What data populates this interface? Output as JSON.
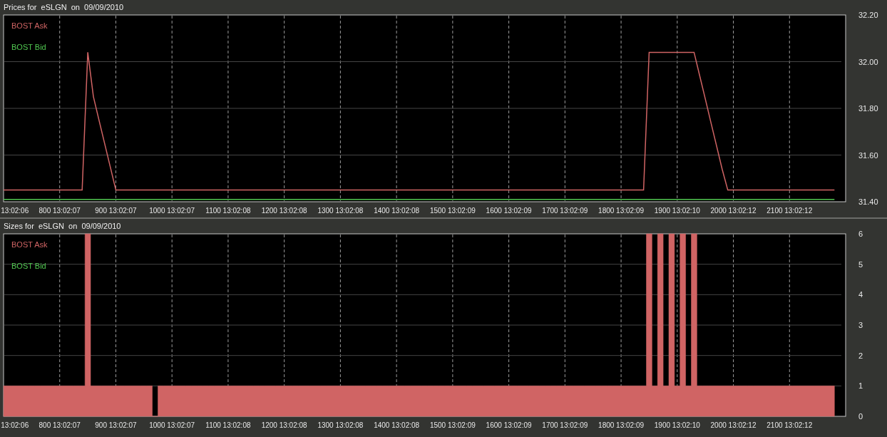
{
  "panels": [
    {
      "title": "Prices for  eSLGN  on  09/09/2010",
      "chart_data": {
        "type": "line",
        "grid": true,
        "categories": [
          null,
          null,
          "13:02:06",
          null,
          null,
          null,
          null,
          null,
          null,
          null,
          "800 13:02:07",
          null,
          null,
          null,
          null,
          null,
          null,
          null,
          null,
          null,
          "900 13:02:07",
          null,
          null,
          null,
          null,
          null,
          null,
          null,
          null,
          null,
          "1000 13:02:07",
          null,
          null,
          null,
          null,
          null,
          null,
          null,
          null,
          null,
          "1100 13:02:08",
          null,
          null,
          null,
          null,
          null,
          null,
          null,
          null,
          null,
          "1200 13:02:08",
          null,
          null,
          null,
          null,
          null,
          null,
          null,
          null,
          null,
          "1300 13:02:08",
          null,
          null,
          null,
          null,
          null,
          null,
          null,
          null,
          null,
          "1400 13:02:08",
          null,
          null,
          null,
          null,
          null,
          null,
          null,
          null,
          null,
          "1500 13:02:09",
          null,
          null,
          null,
          null,
          null,
          null,
          null,
          null,
          null,
          "1600 13:02:09",
          null,
          null,
          null,
          null,
          null,
          null,
          null,
          null,
          null,
          "1700 13:02:09",
          null,
          null,
          null,
          null,
          null,
          null,
          null,
          null,
          null,
          "1800 13:02:09",
          null,
          null,
          null,
          null,
          null,
          null,
          null,
          null,
          null,
          "1900 13:02:10",
          null,
          null,
          null,
          null,
          null,
          null,
          null,
          null,
          null,
          "2000 13:02:12",
          null,
          null,
          null,
          null,
          null,
          null,
          null,
          null,
          null,
          "2100 13:02:12",
          null,
          null,
          null,
          null,
          null,
          null,
          null,
          null,
          null,
          null
        ],
        "series": [
          {
            "name": "BOST Ask",
            "color": "#d06464",
            "values": [
              31.45,
              31.45,
              31.45,
              31.45,
              31.45,
              31.45,
              31.45,
              31.45,
              31.45,
              31.45,
              31.45,
              31.45,
              31.45,
              31.45,
              31.45,
              32.04,
              31.85,
              31.75,
              31.65,
              31.55,
              31.45,
              31.45,
              31.45,
              31.45,
              31.45,
              31.45,
              31.45,
              31.45,
              31.45,
              31.45,
              31.45,
              31.45,
              31.45,
              31.45,
              31.45,
              31.45,
              31.45,
              31.45,
              31.45,
              31.45,
              31.45,
              31.45,
              31.45,
              31.45,
              31.45,
              31.45,
              31.45,
              31.45,
              31.45,
              31.45,
              31.45,
              31.45,
              31.45,
              31.45,
              31.45,
              31.45,
              31.45,
              31.45,
              31.45,
              31.45,
              31.45,
              31.45,
              31.45,
              31.45,
              31.45,
              31.45,
              31.45,
              31.45,
              31.45,
              31.45,
              31.45,
              31.45,
              31.45,
              31.45,
              31.45,
              31.45,
              31.45,
              31.45,
              31.45,
              31.45,
              31.45,
              31.45,
              31.45,
              31.45,
              31.45,
              31.45,
              31.45,
              31.45,
              31.45,
              31.45,
              31.45,
              31.45,
              31.45,
              31.45,
              31.45,
              31.45,
              31.45,
              31.45,
              31.45,
              31.45,
              31.45,
              31.45,
              31.45,
              31.45,
              31.45,
              31.45,
              31.45,
              31.45,
              31.45,
              31.45,
              31.45,
              31.45,
              31.45,
              31.45,
              31.45,
              32.04,
              32.04,
              32.04,
              32.04,
              32.04,
              32.04,
              32.04,
              32.04,
              32.04,
              31.94,
              31.84,
              31.74,
              31.64,
              31.54,
              31.45,
              31.45,
              31.45,
              31.45,
              31.45,
              31.45,
              31.45,
              31.45,
              31.45,
              31.45,
              31.45,
              31.45,
              31.45,
              31.45,
              31.45,
              31.45,
              31.45,
              31.45,
              31.45,
              31.45,
              null,
              null
            ]
          },
          {
            "name": "BOST Bid",
            "color": "#50c850",
            "values": [
              31.41,
              31.41,
              31.41,
              31.41,
              31.41,
              31.41,
              31.41,
              31.41,
              31.41,
              31.41,
              31.41,
              31.41,
              31.41,
              31.41,
              31.41,
              31.41,
              31.41,
              31.41,
              31.41,
              31.41,
              31.41,
              31.41,
              31.41,
              31.41,
              31.41,
              31.41,
              31.41,
              31.41,
              31.41,
              31.41,
              31.41,
              31.41,
              31.41,
              31.41,
              31.41,
              31.41,
              31.41,
              31.41,
              31.41,
              31.41,
              31.41,
              31.41,
              31.41,
              31.41,
              31.41,
              31.41,
              31.41,
              31.41,
              31.41,
              31.41,
              31.41,
              31.41,
              31.41,
              31.41,
              31.41,
              31.41,
              31.41,
              31.41,
              31.41,
              31.41,
              31.41,
              31.41,
              31.41,
              31.41,
              31.41,
              31.41,
              31.41,
              31.41,
              31.41,
              31.41,
              31.41,
              31.41,
              31.41,
              31.41,
              31.41,
              31.41,
              31.41,
              31.41,
              31.41,
              31.41,
              31.41,
              31.41,
              31.41,
              31.41,
              31.41,
              31.41,
              31.41,
              31.41,
              31.41,
              31.41,
              31.41,
              31.41,
              31.41,
              31.41,
              31.41,
              31.41,
              31.41,
              31.41,
              31.41,
              31.41,
              31.41,
              31.41,
              31.41,
              31.41,
              31.41,
              31.41,
              31.41,
              31.41,
              31.41,
              31.41,
              31.41,
              31.41,
              31.41,
              31.41,
              31.41,
              31.41,
              31.41,
              31.41,
              31.41,
              31.41,
              31.41,
              31.41,
              31.41,
              31.41,
              31.41,
              31.41,
              31.41,
              31.41,
              31.41,
              31.41,
              31.41,
              31.41,
              31.41,
              31.41,
              31.41,
              31.41,
              31.41,
              31.41,
              31.41,
              31.41,
              31.41,
              31.41,
              31.41,
              31.41,
              31.41,
              31.41,
              31.41,
              31.41,
              31.41,
              null,
              null
            ]
          }
        ],
        "ylim": [
          31.4,
          32.2
        ],
        "yticks": [
          {
            "value": 31.4,
            "label": "31.40"
          },
          {
            "value": 31.6,
            "label": "31.60"
          },
          {
            "value": 31.8,
            "label": "31.80"
          },
          {
            "value": 32.0,
            "label": "32.00"
          },
          {
            "value": 32.2,
            "label": "32.20"
          }
        ]
      }
    },
    {
      "title": "Sizes for  eSLGN  on  09/09/2010",
      "legend": [
        {
          "label": "BOST Bid",
          "color": "#50c850"
        }
      ],
      "chart_data": {
        "type": "area",
        "grid": true,
        "categories": [
          null,
          null,
          "13:02:06",
          null,
          null,
          null,
          null,
          null,
          null,
          null,
          "800 13:02:07",
          null,
          null,
          null,
          null,
          null,
          null,
          null,
          null,
          null,
          "900 13:02:07",
          null,
          null,
          null,
          null,
          null,
          null,
          null,
          null,
          null,
          "1000 13:02:07",
          null,
          null,
          null,
          null,
          null,
          null,
          null,
          null,
          null,
          "1100 13:02:08",
          null,
          null,
          null,
          null,
          null,
          null,
          null,
          null,
          null,
          "1200 13:02:08",
          null,
          null,
          null,
          null,
          null,
          null,
          null,
          null,
          null,
          "1300 13:02:08",
          null,
          null,
          null,
          null,
          null,
          null,
          null,
          null,
          null,
          "1400 13:02:08",
          null,
          null,
          null,
          null,
          null,
          null,
          null,
          null,
          null,
          "1500 13:02:09",
          null,
          null,
          null,
          null,
          null,
          null,
          null,
          null,
          null,
          "1600 13:02:09",
          null,
          null,
          null,
          null,
          null,
          null,
          null,
          null,
          null,
          "1700 13:02:09",
          null,
          null,
          null,
          null,
          null,
          null,
          null,
          null,
          null,
          "1800 13:02:09",
          null,
          null,
          null,
          null,
          null,
          null,
          null,
          null,
          null,
          "1900 13:02:10",
          null,
          null,
          null,
          null,
          null,
          null,
          null,
          null,
          null,
          "2000 13:02:12",
          null,
          null,
          null,
          null,
          null,
          null,
          null,
          null,
          null,
          "2100 13:02:12",
          null,
          null,
          null,
          null,
          null,
          null,
          null,
          null,
          null,
          null
        ],
        "series": [
          {
            "name": "BOST Ask",
            "color": "#d06464",
            "values": [
              1,
              1,
              1,
              1,
              1,
              1,
              1,
              1,
              1,
              1,
              1,
              1,
              1,
              1,
              1,
              6,
              1,
              1,
              1,
              1,
              1,
              1,
              1,
              1,
              1,
              1,
              1,
              0,
              1,
              1,
              1,
              1,
              1,
              1,
              1,
              1,
              1,
              1,
              1,
              1,
              1,
              1,
              1,
              1,
              1,
              1,
              1,
              1,
              1,
              1,
              1,
              1,
              1,
              1,
              1,
              1,
              1,
              1,
              1,
              1,
              1,
              1,
              1,
              1,
              1,
              1,
              1,
              1,
              1,
              1,
              1,
              1,
              1,
              1,
              1,
              1,
              1,
              1,
              1,
              1,
              1,
              1,
              1,
              1,
              1,
              1,
              1,
              1,
              1,
              1,
              1,
              1,
              1,
              1,
              1,
              1,
              1,
              1,
              1,
              1,
              1,
              1,
              1,
              1,
              1,
              1,
              1,
              1,
              1,
              1,
              1,
              1,
              1,
              1,
              1,
              6,
              1,
              6,
              1,
              6,
              1,
              6,
              1,
              6,
              1,
              1,
              1,
              1,
              1,
              1,
              1,
              1,
              1,
              1,
              1,
              1,
              1,
              1,
              1,
              1,
              1,
              1,
              1,
              1,
              1,
              1,
              1,
              1,
              1,
              null,
              null
            ]
          }
        ],
        "ylim": [
          0,
          6
        ],
        "yticks": [
          {
            "value": 0,
            "label": "0"
          },
          {
            "value": 1,
            "label": "1"
          },
          {
            "value": 2,
            "label": "2"
          },
          {
            "value": 3,
            "label": "3"
          },
          {
            "value": 4,
            "label": "4"
          },
          {
            "value": 5,
            "label": "5"
          },
          {
            "value": 6,
            "label": "6"
          }
        ]
      }
    }
  ]
}
